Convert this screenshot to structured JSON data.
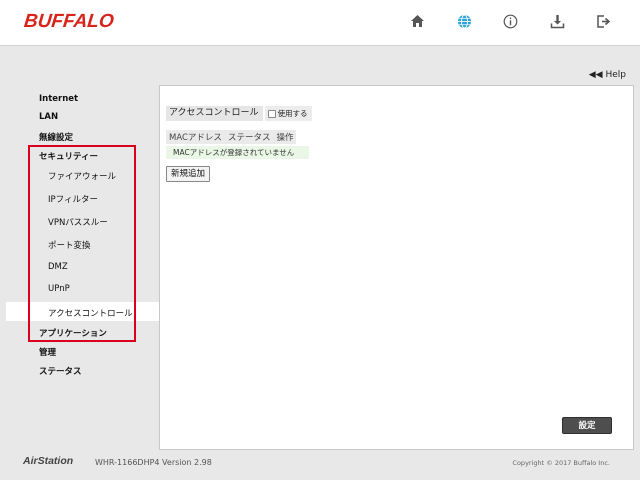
{
  "header": {
    "brand": "BUFFALO",
    "icons": [
      "home-icon",
      "globe-icon",
      "info-icon",
      "download-icon",
      "logout-icon"
    ],
    "accent": "#d8251c",
    "active_icon_color": "#2aa1d8"
  },
  "help": {
    "label": "Help"
  },
  "sidebar": {
    "items": [
      {
        "label": "Internet"
      },
      {
        "label": "LAN"
      },
      {
        "label": "無線設定"
      },
      {
        "label": "セキュリティー"
      },
      {
        "label": "アプリケーション"
      },
      {
        "label": "管理"
      },
      {
        "label": "ステータス"
      }
    ],
    "security_sub": [
      {
        "label": "ファイアウォール"
      },
      {
        "label": "IPフィルター"
      },
      {
        "label": "VPNパススルー"
      },
      {
        "label": "ポート変換"
      },
      {
        "label": "DMZ"
      },
      {
        "label": "UPnP"
      },
      {
        "label": "アクセスコントロール"
      }
    ],
    "highlight_color": "#d8001c"
  },
  "main": {
    "title": "アクセスコントロール",
    "use_label": "使用する",
    "use_checked": false,
    "table_headers": [
      "MACアドレス",
      "ステータス",
      "操作"
    ],
    "empty_message": "MACアドレスが登録されていません",
    "add_button": "新規追加",
    "save_button": "設定"
  },
  "footer": {
    "logo": "AirStation",
    "model": "WHR-1166DHP4 Version 2.98",
    "copyright": "Copyright © 2017 Buffalo Inc."
  }
}
